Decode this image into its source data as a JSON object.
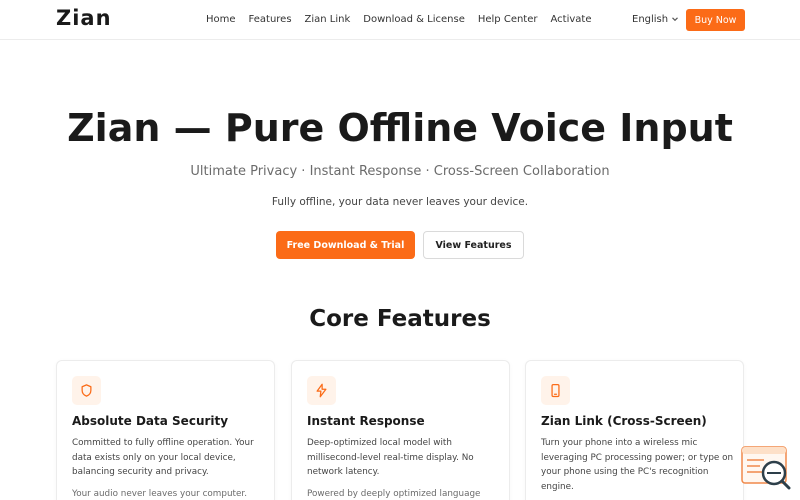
{
  "brand": {
    "logo": "Zian",
    "accent": "#fb6b17"
  },
  "nav": {
    "items": [
      "Home",
      "Features",
      "Zian Link",
      "Download & License",
      "Help Center",
      "Activate"
    ],
    "language": "English",
    "buy_label": "Buy Now"
  },
  "hero": {
    "title": "Zian — Pure Offline Voice Input",
    "subtitle": "Ultimate Privacy · Instant Response · Cross-Screen Collaboration",
    "description": "Fully offline, your data never leaves your device.",
    "primary_cta": "Free Download & Trial",
    "secondary_cta": "View Features"
  },
  "features": {
    "title": "Core Features",
    "cards": [
      {
        "icon": "shield-icon",
        "title": "Absolute Data Security",
        "text": "Committed to fully offline operation. Your data exists only on your local device, balancing security and privacy.",
        "text2": "Your audio never leaves your computer."
      },
      {
        "icon": "lightning-icon",
        "title": "Instant Response",
        "text": "Deep-optimized local model with millisecond-level real-time display. No network latency.",
        "text2": "Powered by deeply optimized language"
      },
      {
        "icon": "phone-icon",
        "title": "Zian Link (Cross-Screen)",
        "text": "Turn your phone into a wireless mic leveraging PC processing power; or type on your phone using the PC's recognition engine.",
        "text2": ""
      }
    ]
  }
}
